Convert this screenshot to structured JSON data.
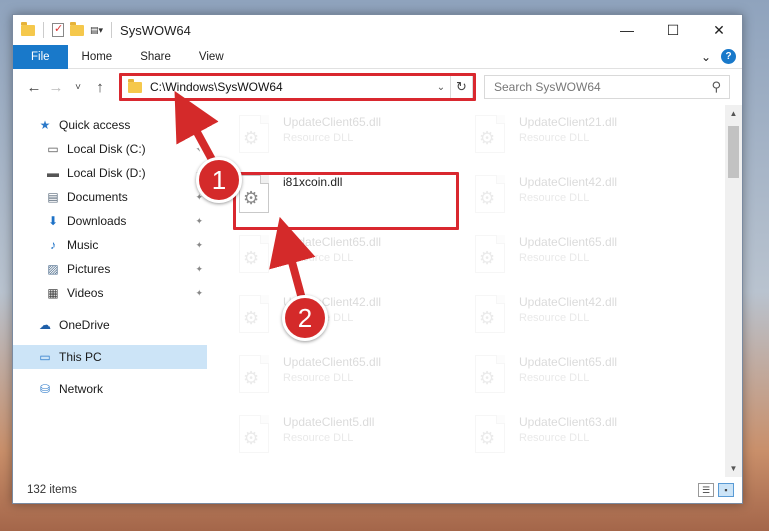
{
  "window": {
    "title": "SysWOW64",
    "controls": {
      "minimize": "—",
      "maximize": "☐",
      "close": "✕"
    }
  },
  "ribbon": {
    "tabs": [
      "File",
      "Home",
      "Share",
      "View"
    ],
    "expand_glyph": "⌄",
    "help_glyph": "?"
  },
  "navigation": {
    "back": "←",
    "forward": "→",
    "recent": "˅",
    "up": "↑"
  },
  "address": {
    "path": "C:\\Windows\\SysWOW64",
    "dropdown": "⌄",
    "refresh": "↻"
  },
  "search": {
    "placeholder": "Search SysWOW64",
    "icon": "⚲"
  },
  "sidebar": {
    "items": [
      {
        "label": "Quick access",
        "icon": "star-icon",
        "glyph": "★",
        "color": "#2b79c9",
        "pinned": false
      },
      {
        "label": "Local Disk (C:)",
        "icon": "drive-icon",
        "glyph": "▭",
        "color": "#555555",
        "pinned": true
      },
      {
        "label": "Local Disk (D:)",
        "icon": "drive-icon",
        "glyph": "▬",
        "color": "#555555",
        "pinned": true
      },
      {
        "label": "Documents",
        "icon": "documents-icon",
        "glyph": "▤",
        "color": "#5b6b7c",
        "pinned": true
      },
      {
        "label": "Downloads",
        "icon": "downloads-icon",
        "glyph": "⬇",
        "color": "#1e72c7",
        "pinned": true
      },
      {
        "label": "Music",
        "icon": "music-icon",
        "glyph": "♪",
        "color": "#1e72c7",
        "pinned": true
      },
      {
        "label": "Pictures",
        "icon": "pictures-icon",
        "glyph": "▨",
        "color": "#4a6a8a",
        "pinned": true
      },
      {
        "label": "Videos",
        "icon": "videos-icon",
        "glyph": "▦",
        "color": "#444444",
        "pinned": true
      },
      {
        "label": "OneDrive",
        "icon": "onedrive-icon",
        "glyph": "☁",
        "color": "#1e5fa8",
        "pinned": false
      },
      {
        "label": "This PC",
        "icon": "this-pc-icon",
        "glyph": "▭",
        "color": "#2b79c9",
        "pinned": false,
        "selected": true
      },
      {
        "label": "Network",
        "icon": "network-icon",
        "glyph": "⛁",
        "color": "#2b79c9",
        "pinned": false
      }
    ],
    "pin_glyph": "📌"
  },
  "files": {
    "left_column": [
      {
        "name": "UpdateClient65.dll",
        "type": "Resource DLL",
        "faded": true
      },
      {
        "name": "i81xcoin.dll",
        "type": "",
        "faded": false,
        "highlighted": true
      },
      {
        "name": "UpdateClient65.dll",
        "type": "Resource DLL",
        "faded": true
      },
      {
        "name": "UpdateClient42.dll",
        "type": "Resource DLL",
        "faded": true
      },
      {
        "name": "UpdateClient65.dll",
        "type": "Resource DLL",
        "faded": true
      },
      {
        "name": "UpdateClient5.dll",
        "type": "Resource DLL",
        "faded": true
      }
    ],
    "right_column": [
      {
        "name": "UpdateClient21.dll",
        "type": "Resource DLL",
        "faded": true
      },
      {
        "name": "UpdateClient42.dll",
        "type": "Resource DLL",
        "faded": true
      },
      {
        "name": "UpdateClient65.dll",
        "type": "Resource DLL",
        "faded": true
      },
      {
        "name": "UpdateClient42.dll",
        "type": "Resource DLL",
        "faded": true
      },
      {
        "name": "UpdateClient65.dll",
        "type": "Resource DLL",
        "faded": true
      },
      {
        "name": "UpdateClient63.dll",
        "type": "Resource DLL",
        "faded": true
      }
    ],
    "file_icon": "dll-gear-icon",
    "gear_glyph": "⚙"
  },
  "status": {
    "item_count": "132 items"
  },
  "annotations": {
    "color": "#d9282f",
    "steps": [
      "1",
      "2"
    ]
  }
}
